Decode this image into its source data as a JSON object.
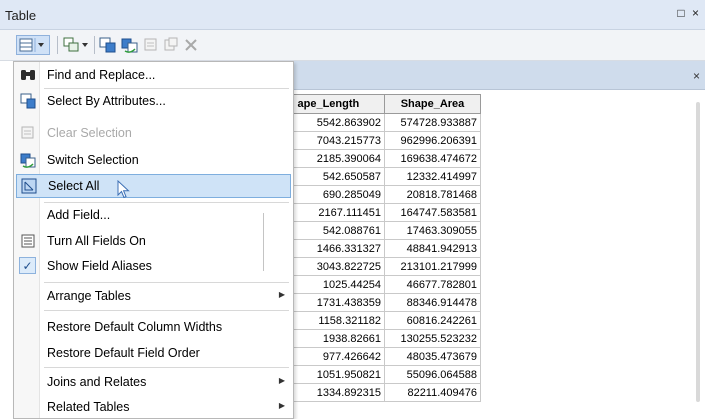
{
  "window": {
    "title": "Table",
    "controls": "□ ×"
  },
  "toolbar": {
    "buttons": [
      "table-options-icon",
      "related-tables-icon",
      "select-by-attributes-icon",
      "switch-selection-icon",
      "clear-selection-icon",
      "delete-selected-icon"
    ]
  },
  "tab_close": "×",
  "menu": {
    "items": [
      {
        "label": "Find and Replace...",
        "icon": "binoculars-icon",
        "state": "normal"
      },
      {
        "label": "Select By Attributes...",
        "icon": "select-by-attributes-icon",
        "state": "normal"
      },
      {
        "label": "Clear Selection",
        "icon": "clear-selection-icon",
        "state": "disabled"
      },
      {
        "label": "Switch Selection",
        "icon": "switch-selection-icon",
        "state": "normal"
      },
      {
        "label": "Select All",
        "icon": "select-all-icon",
        "state": "highlighted"
      },
      {
        "label": "Add Field...",
        "icon": "",
        "state": "normal"
      },
      {
        "label": "Turn All Fields On",
        "icon": "field-list-icon",
        "state": "normal"
      },
      {
        "label": "Show Field Aliases",
        "icon": "checkmark-icon",
        "state": "checked"
      },
      {
        "label": "Arrange Tables",
        "icon": "",
        "state": "submenu"
      },
      {
        "label": "Restore Default Column Widths",
        "icon": "",
        "state": "normal"
      },
      {
        "label": "Restore Default Field Order",
        "icon": "",
        "state": "normal"
      },
      {
        "label": "Joins and Relates",
        "icon": "",
        "state": "submenu"
      },
      {
        "label": "Related Tables",
        "icon": "",
        "state": "submenu"
      }
    ]
  },
  "table": {
    "columns": [
      "ape_Length",
      "Shape_Area"
    ],
    "rows": [
      [
        "5542.863902",
        "574728.933887"
      ],
      [
        "7043.215773",
        "962996.206391"
      ],
      [
        "2185.390064",
        "169638.474672"
      ],
      [
        "542.650587",
        "12332.414997"
      ],
      [
        "690.285049",
        "20818.781468"
      ],
      [
        "2167.111451",
        "164747.583581"
      ],
      [
        "542.088761",
        "17463.309055"
      ],
      [
        "1466.331327",
        "48841.942913"
      ],
      [
        "3043.822725",
        "213101.217999"
      ],
      [
        "1025.44254",
        "46677.782801"
      ],
      [
        "1731.438359",
        "88346.914478"
      ],
      [
        "1158.321182",
        "60816.242261"
      ],
      [
        "1938.82661",
        "130255.523232"
      ],
      [
        "977.426642",
        "48035.473679"
      ],
      [
        "1051.950821",
        "55096.064588"
      ],
      [
        "1334.892315",
        "82211.409476"
      ]
    ]
  },
  "colors": {
    "titlebar": "#dfe8f5",
    "highlight": "#cfe3f7",
    "highlight_border": "#7eaede"
  }
}
